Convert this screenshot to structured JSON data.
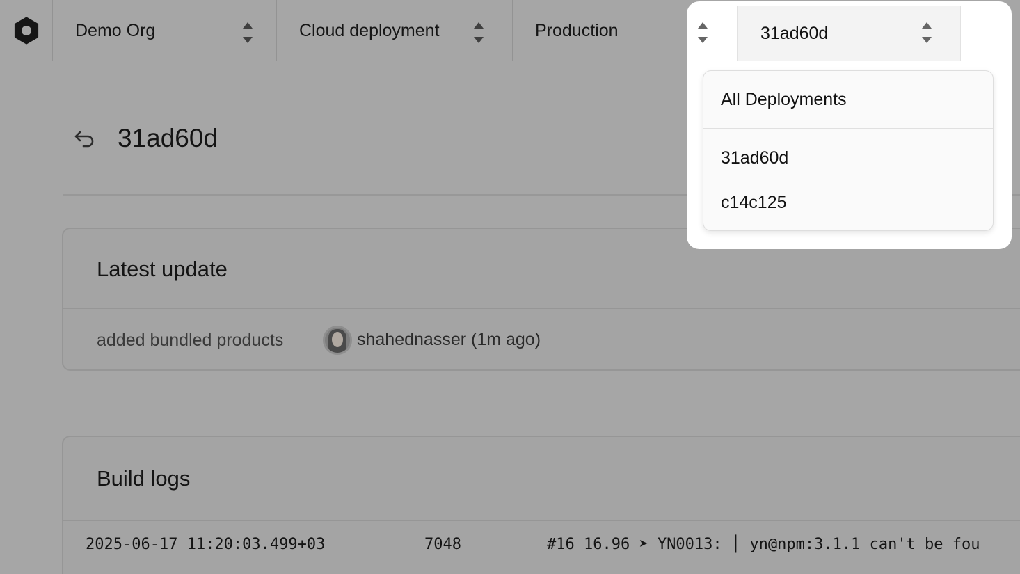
{
  "topbar": {
    "logo_icon": "hexagon-logo-icon",
    "org": "Demo Org",
    "project": "Cloud deployment",
    "environment": "Production",
    "deployment": "31ad60d"
  },
  "page": {
    "title": "31ad60d",
    "back_icon": "undo-arrow-icon"
  },
  "latest_update": {
    "title": "Latest update",
    "commit_message": "added bundled products",
    "author": "shahednasser (1m ago)"
  },
  "build_logs": {
    "title": "Build logs",
    "lines": [
      {
        "timestamp": "2025-06-17 11:20:03.499+03",
        "number": "7048",
        "message": "#16 16.96 ➤ YN0013: │ yn@npm:3.1.1 can't be fou"
      }
    ]
  },
  "dropdown": {
    "header": "All Deployments",
    "items": [
      "31ad60d",
      "c14c125"
    ]
  }
}
